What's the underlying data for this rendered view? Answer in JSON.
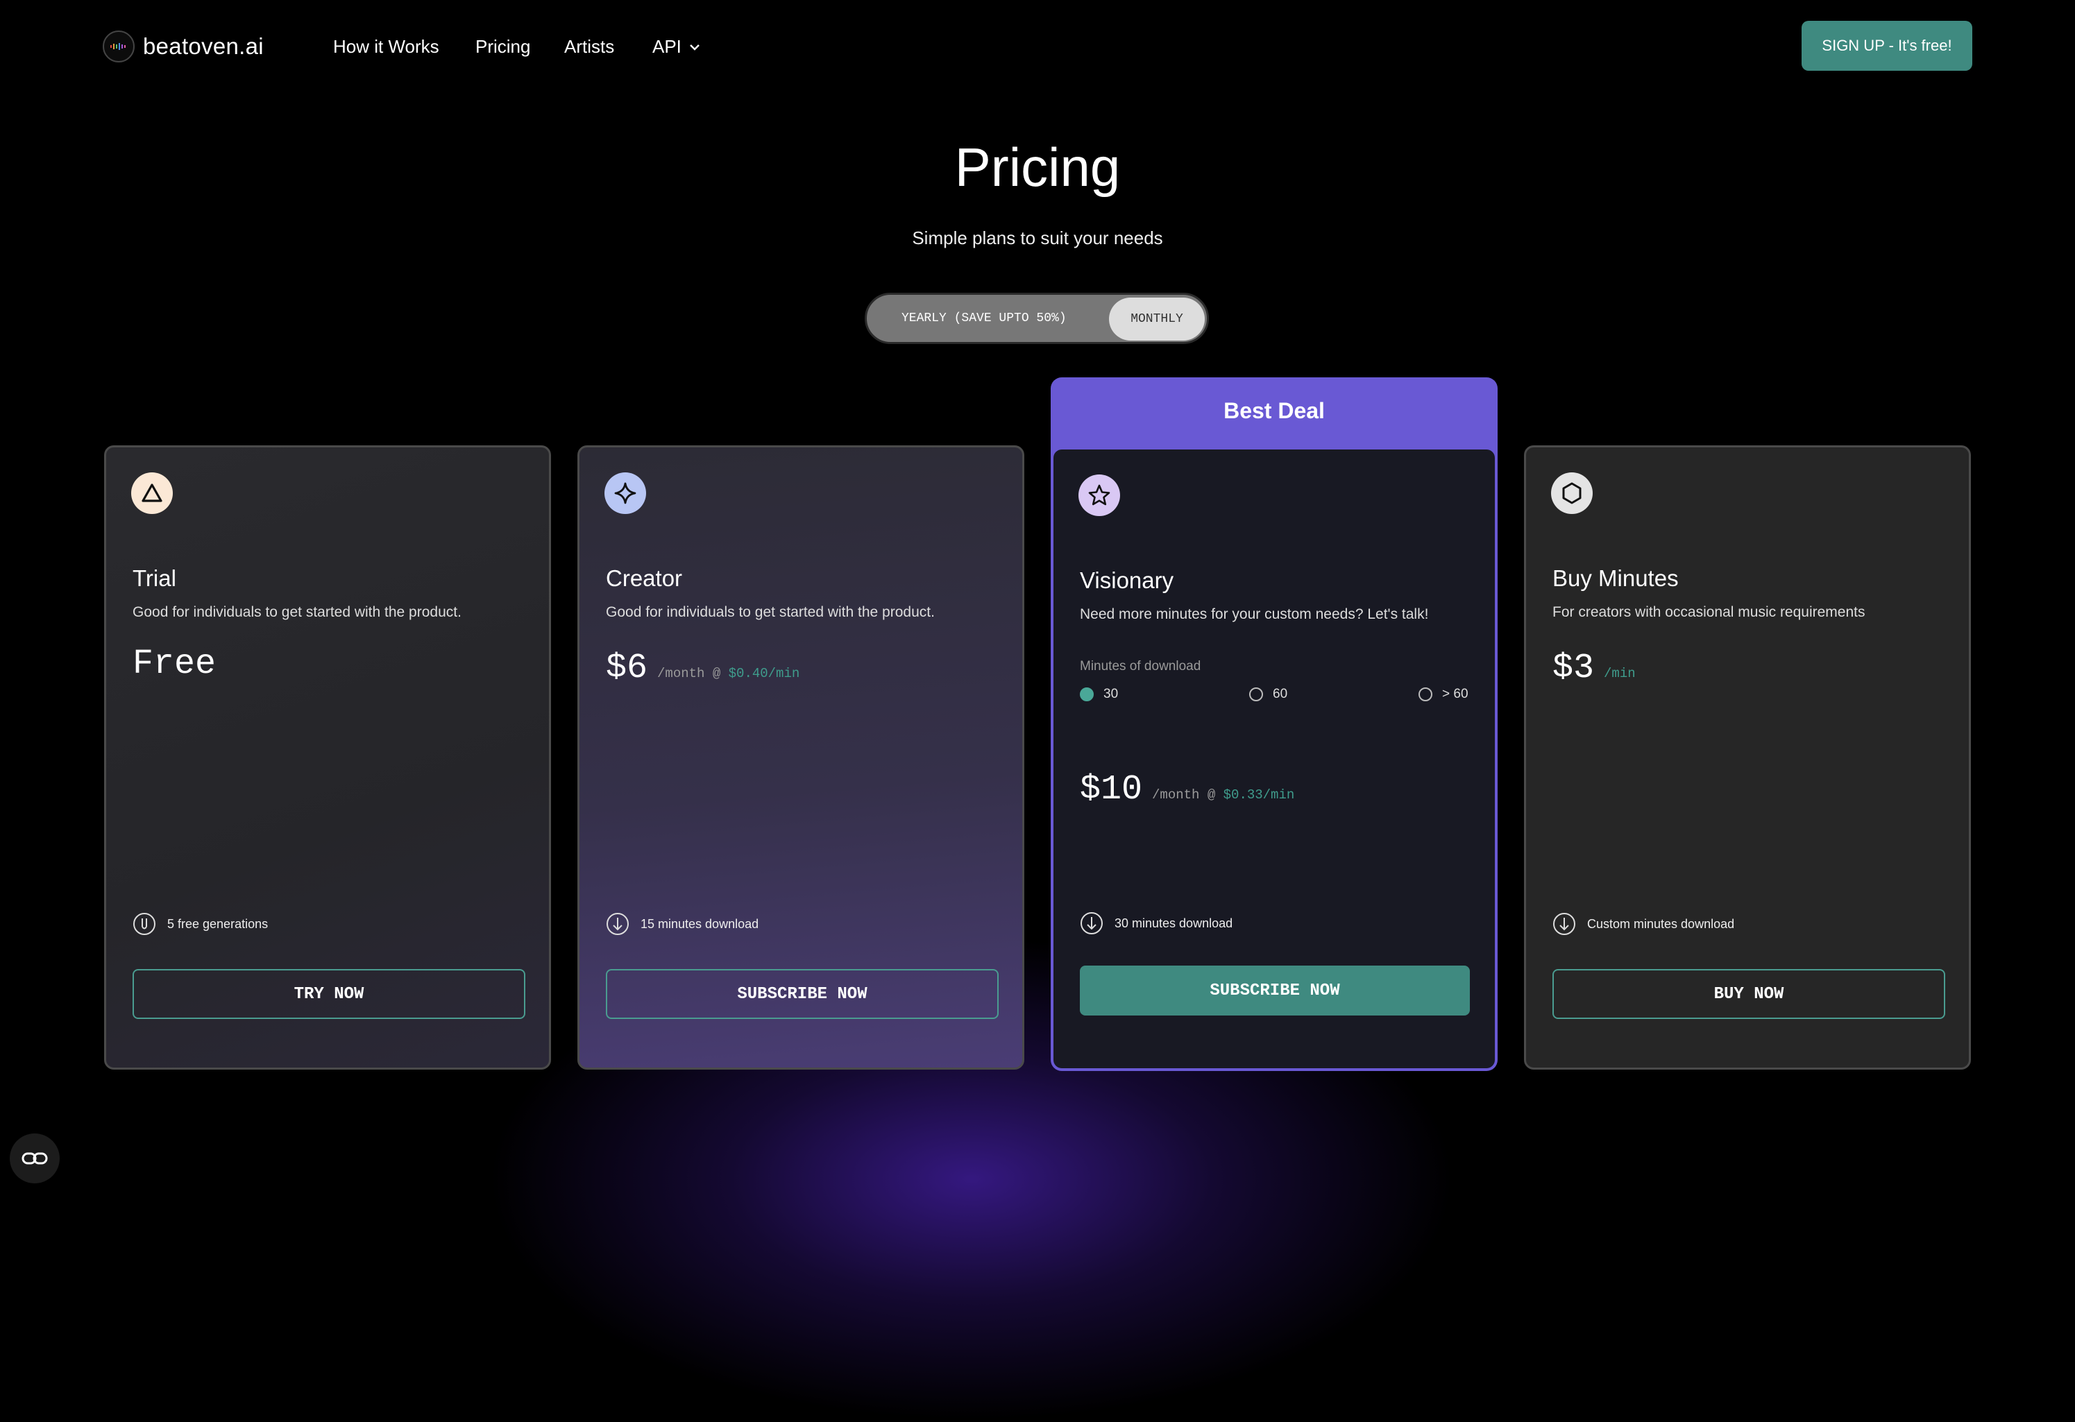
{
  "nav": {
    "logo_text": "beatoven.ai",
    "links": [
      "How it Works",
      "Pricing",
      "Artists"
    ],
    "api_label": "API",
    "signup_label": "SIGN UP - It's free!"
  },
  "hero": {
    "title": "Pricing",
    "subtitle": "Simple plans to suit your needs"
  },
  "billing_toggle": {
    "yearly_label": "YEARLY (SAVE UPTO 50%)",
    "monthly_label": "MONTHLY",
    "selected": "MONTHLY"
  },
  "plans": {
    "trial": {
      "name": "Trial",
      "description": "Good for individuals to get started with the product.",
      "price": "Free",
      "feature": "5 free generations",
      "button": "TRY NOW"
    },
    "creator": {
      "name": "Creator",
      "description": "Good for individuals to get started with the product.",
      "price": "$6",
      "period": "/month @",
      "rate": "$0.40/min",
      "feature": "15 minutes download",
      "button": "SUBSCRIBE NOW"
    },
    "visionary": {
      "badge": "Best Deal",
      "name": "Visionary",
      "description": "Need more minutes for your custom needs? Let's talk!",
      "minutes_label": "Minutes of download",
      "minute_options": [
        "30",
        "60",
        "> 60"
      ],
      "selected_minutes": "30",
      "price": "$10",
      "period": "/month @",
      "rate": "$0.33/min",
      "feature": "30 minutes download",
      "button": "SUBSCRIBE NOW"
    },
    "buy_minutes": {
      "name": "Buy Minutes",
      "description": "For creators with occasional music requirements",
      "price": "$3",
      "period": "/min",
      "feature": "Custom minutes download",
      "button": "BUY NOW"
    }
  },
  "colors": {
    "accent": "#3f8a80",
    "best_deal": "#6959d4",
    "rate_text": "#3f9c8c"
  }
}
